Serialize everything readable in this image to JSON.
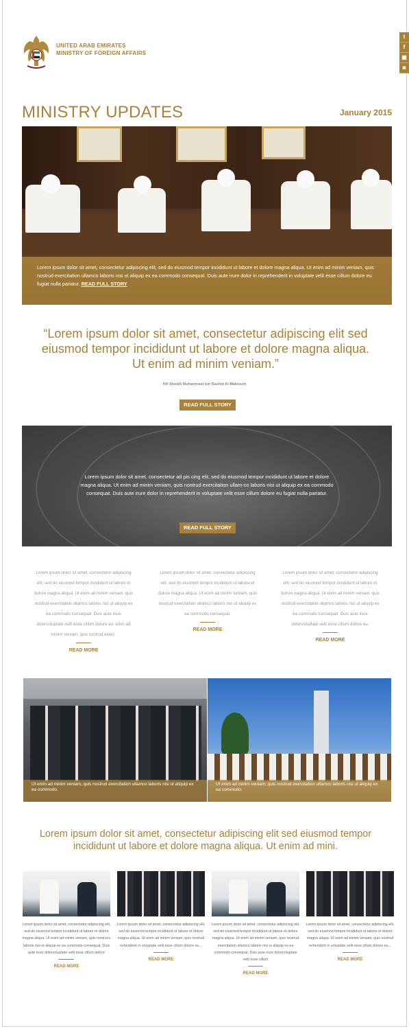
{
  "header": {
    "org_line1": "UNITED ARAB EMIRATES",
    "org_line2": "MINISTRY OF FOREIGN AFFAIRS",
    "logo_icon": "uae-eagle-emblem-icon",
    "social": [
      "twitter-icon",
      "facebook-icon",
      "youtube-icon",
      "instagram-icon"
    ]
  },
  "title": "MINISTRY UPDATES",
  "date": "January 2015",
  "hero": {
    "caption": "Lorem ipsum dolor sit amet, consectetur adipiscing elit, sed do eiusmod tempor incididunt ut labore et dolore magna aliqua. Ut enim ad minim veniam, quis nostrud exercitation ullamco laboris nisi ut aliquip ex ea commodo consequat. Duis aute irure dolor in reprehenderit in voluptate velit esse cillum dolore eu fugiat nulla pariatur.",
    "link": "READ FULL STORY"
  },
  "quote": {
    "text": "“Lorem ipsum dolor sit amet, consectetur adipiscing elit sed eiusmod tempor incididunt ut labore et dolore magna aliqua. Ut enim ad minim veniam.”",
    "author": "HH Sheikh Mohammed bin Rashid Al Maktoum",
    "button": "READ FULL STORY"
  },
  "banner": {
    "text": "Lorem ipsum dolor sit amet, consectetur ad pis cing elit, sed do eiusmod tempor incididunt ut labore et dolore magna aliqua. Ut enim ad minim veniam, quis nostrud exercitation ullam-co laboris nisi ut aliquip ex ea commodo consequat. Duis aute irure dolor in reprehenderit in voluptate velit esse cillum dolore eu fugiat nulla pariatur.",
    "button": "READ FULL STORY"
  },
  "columns": [
    {
      "text": "Lorem ipsum dolor sit amet, consectetur adipiscing elit, sed do eiusmod tempor incididunt ut labore et dolore magna aliqua. Ut enim ad minim veniam, quis nostrud exercitation ullamco laboris nisi ut aliquip ex ea commodo consequat. Duis aute irure dolorvoluptate velit esse cillum dolore eu. enim ad minim veniam, quis nostrud exerc.",
      "more": "READ MORE"
    },
    {
      "text": "Lorem ipsum dolor sit amet, consectetur adipiscing elit, sed do eiusmod tempor incididunt ut labore et dolore magna aliqua. Ut enim ad minim veniam, quis nostrud exercitation ullamco laboris nisi ut aliquip ex ea commodo consequat.",
      "more": "READ MORE"
    },
    {
      "text": "Lorem ipsum dolor sit amet, consectetur adipiscing elit, sed do eiusmod tempor incididunt ut labore et dolore magna aliqua. Ut enim ad minim veniam, quis nostrud exercitation ullamco laboris nisi ut aliquip ex ea commodo consequat. Duis aute irure dolorvoluptate velit esse cillum dolore eu.",
      "more": "READ MORE"
    }
  ],
  "photos": [
    {
      "caption": "Ut enim ad minim veniam, quis nostrud exercitation ullamco laboris nisi ut aliquip ex ea commodo."
    },
    {
      "caption": "Ut enim ad minim veniam, quis nostrud exercitation ullamco laboris nisi ut aliquip ex ea commodo."
    }
  ],
  "quote2": "Lorem ipsum dolor sit amet, consectetur adipiscing elit sed  eiusmod tempor incididunt ut labore et dolore magna aliqua. Ut enim ad mini.",
  "cards": [
    {
      "text": "Lorem ipsum dolor sit amet, consectetur adipiscing elit, sed do eiusmod tempor incididunt ut labore et dolore magna aliqua. Ut enim ad minim veniam, quis nostruco laboris nisi ut aliquip ex ea commodo consequat. Duis aute irure dolorvoluptate velit esse cillum dolore",
      "more": "READ MORE"
    },
    {
      "text": "Lorem ipsum dolor sit amet, consectetur adipiscing elit, sed do eiusmod tempor incididunt ut labore et dolore magna aliqua. Ut enim ad minim veniam, quis nostrud exhenderit in voluptate velit esse cillum dolore eu...",
      "more": "READ MORE"
    },
    {
      "text": "Lorem ipsum dolor sit amet, consectetur adipiscing elit, sed do eiusmod tempor incididunt ut labore et dolore magna aliqua. Ut enim ad minim veniam, quis nostrud exercitation ullamco laboris nisi ut aliquip ex ea commodo consequat. Duis aute irure dolorvoluptate velit esse cillum",
      "more": "READ MORE"
    },
    {
      "text": "Lorem ipsum dolor sit amet, consectetur adipiscing elit, sed do eiusmod tempor incididunt ut labore et dolore magna aliqua. Ut enim ad minim veniam, quis nostrud exhenderit in voluptate velit esse cillum dolore eu...",
      "more": "READ MORE"
    }
  ]
}
